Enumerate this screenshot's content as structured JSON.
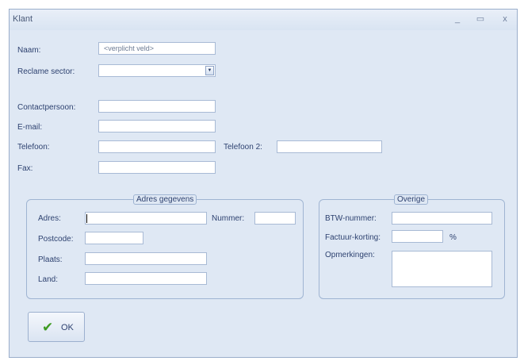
{
  "window": {
    "title": "Klant",
    "controls": [
      "_",
      "▭",
      "x"
    ]
  },
  "form": {
    "naam_label": "Naam:",
    "naam_placeholder": "<verplicht veld>",
    "sector_label": "Reclame sector:",
    "contact_label": "Contactpersoon:",
    "email_label": "E-mail:",
    "telefoon_label": "Telefoon:",
    "telefoon2_label": "Telefoon 2:",
    "fax_label": "Fax:"
  },
  "adres_group": {
    "title": "Adres gegevens",
    "adres_label": "Adres:",
    "nummer_label": "Nummer:",
    "postcode_label": "Postcode:",
    "plaats_label": "Plaats:",
    "land_label": "Land:"
  },
  "overige_group": {
    "title": "Overige",
    "btw_label": "BTW-nummer:",
    "korting_label": "Factuur-korting:",
    "percent": "%",
    "opmerkingen_label": "Opmerkingen:"
  },
  "buttons": {
    "ok_label": "OK"
  },
  "colors": {
    "window_bg": "#dfe8f4",
    "border": "#9fb4d2",
    "label_text": "#2e4270",
    "check_icon": "#3e9b22"
  }
}
